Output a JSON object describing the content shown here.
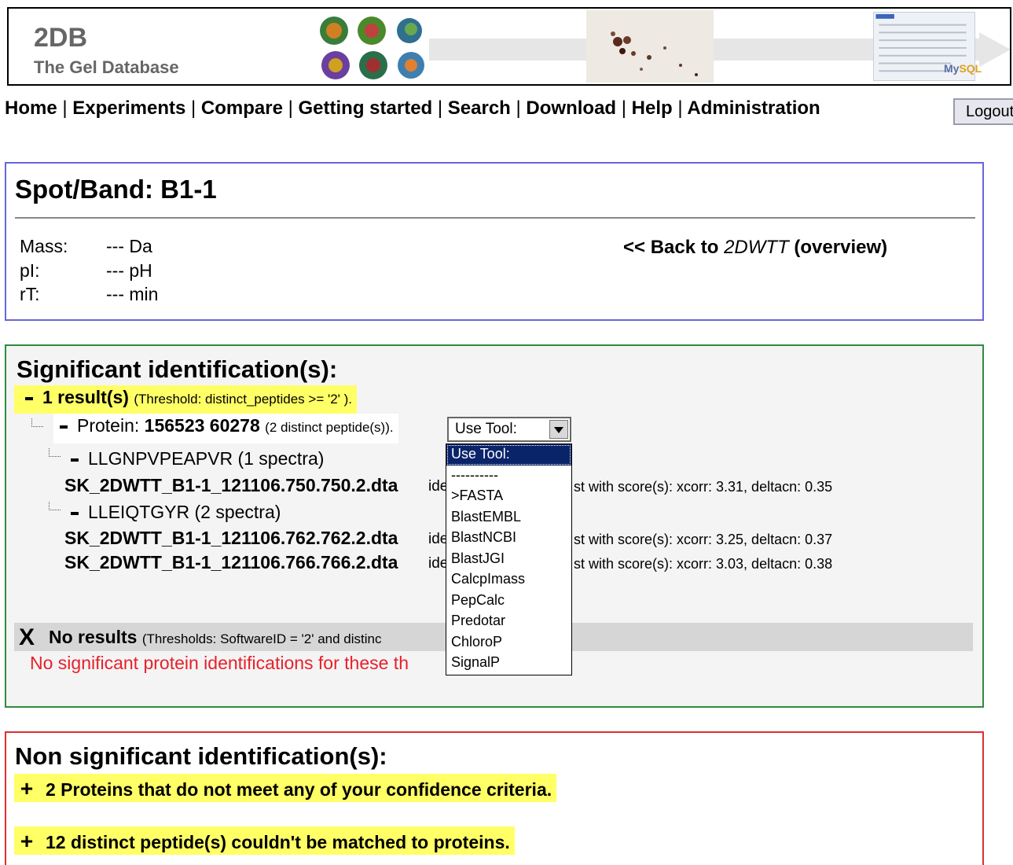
{
  "header": {
    "logo_title": "2DB",
    "logo_subtitle": "The Gel Database",
    "mysql_label_a": "My",
    "mysql_label_b": "SQL"
  },
  "nav": {
    "items": [
      "Home",
      "Experiments",
      "Compare",
      "Getting started",
      "Search",
      "Download",
      "Help",
      "Administration"
    ],
    "separator": "|",
    "logout_label": "Logout"
  },
  "spot": {
    "title": "Spot/Band: B1-1",
    "props": [
      {
        "label": "Mass:",
        "value": "--- Da"
      },
      {
        "label": "pI:",
        "value": "--- pH"
      },
      {
        "label": "rT:",
        "value": "--- min"
      }
    ],
    "back_prefix": "<< Back to",
    "back_experiment": "2DWTT",
    "back_suffix": "(overview)"
  },
  "significant": {
    "title": "Significant identification(s):",
    "result_count": "1 result(s)",
    "result_threshold": "(Threshold: distinct_peptides >= '2' ).",
    "protein_label": "Protein:",
    "protein_id": "156523 60278",
    "protein_detail": "(2 distinct peptide(s)).",
    "tool_select": "Use Tool:",
    "peptides": [
      {
        "sequence": "LLGNPVPEAPVR (1 spectra)",
        "spectra": [
          {
            "file": "SK_2DWTT_B1-1_121106.750.750.2.dta",
            "ide": "ide",
            "score": "st with score(s): xcorr: 3.31, deltacn: 0.35"
          }
        ]
      },
      {
        "sequence": "LLEIQTGYR (2 spectra)",
        "spectra": [
          {
            "file": "SK_2DWTT_B1-1_121106.762.762.2.dta",
            "ide": "ide",
            "score": "st with score(s): xcorr: 3.25, deltacn: 0.37"
          },
          {
            "file": "SK_2DWTT_B1-1_121106.766.766.2.dta",
            "ide": "ide",
            "score": "st with score(s): xcorr: 3.03, deltacn: 0.38"
          }
        ]
      }
    ],
    "no_results_icon": "X",
    "no_results_label": "No results",
    "no_results_threshold": "(Thresholds: SoftwareID = '2' and distinc",
    "no_results_message": "No significant protein identifications for these th"
  },
  "dropdown": {
    "options": [
      "Use Tool:",
      "----------",
      ">FASTA",
      "BlastEMBL",
      "BlastNCBI",
      "BlastJGI",
      "CalcpImass",
      "PepCalc",
      "Predotar",
      "ChloroP",
      "SignalP"
    ],
    "selected": "Use Tool:"
  },
  "non_significant": {
    "title": "Non significant identification(s):",
    "items": [
      "2 Proteins that do not meet any of your confidence criteria.",
      "12 distinct peptide(s) couldn't be matched to proteins."
    ]
  },
  "colors": {
    "highlight": "#ffff66",
    "spot_border": "#6666dd",
    "significant_border": "#2e8b3e",
    "nonsignificant_border": "#e03030",
    "error_text": "#e8202a",
    "dropdown_selected": "#0a246a"
  }
}
